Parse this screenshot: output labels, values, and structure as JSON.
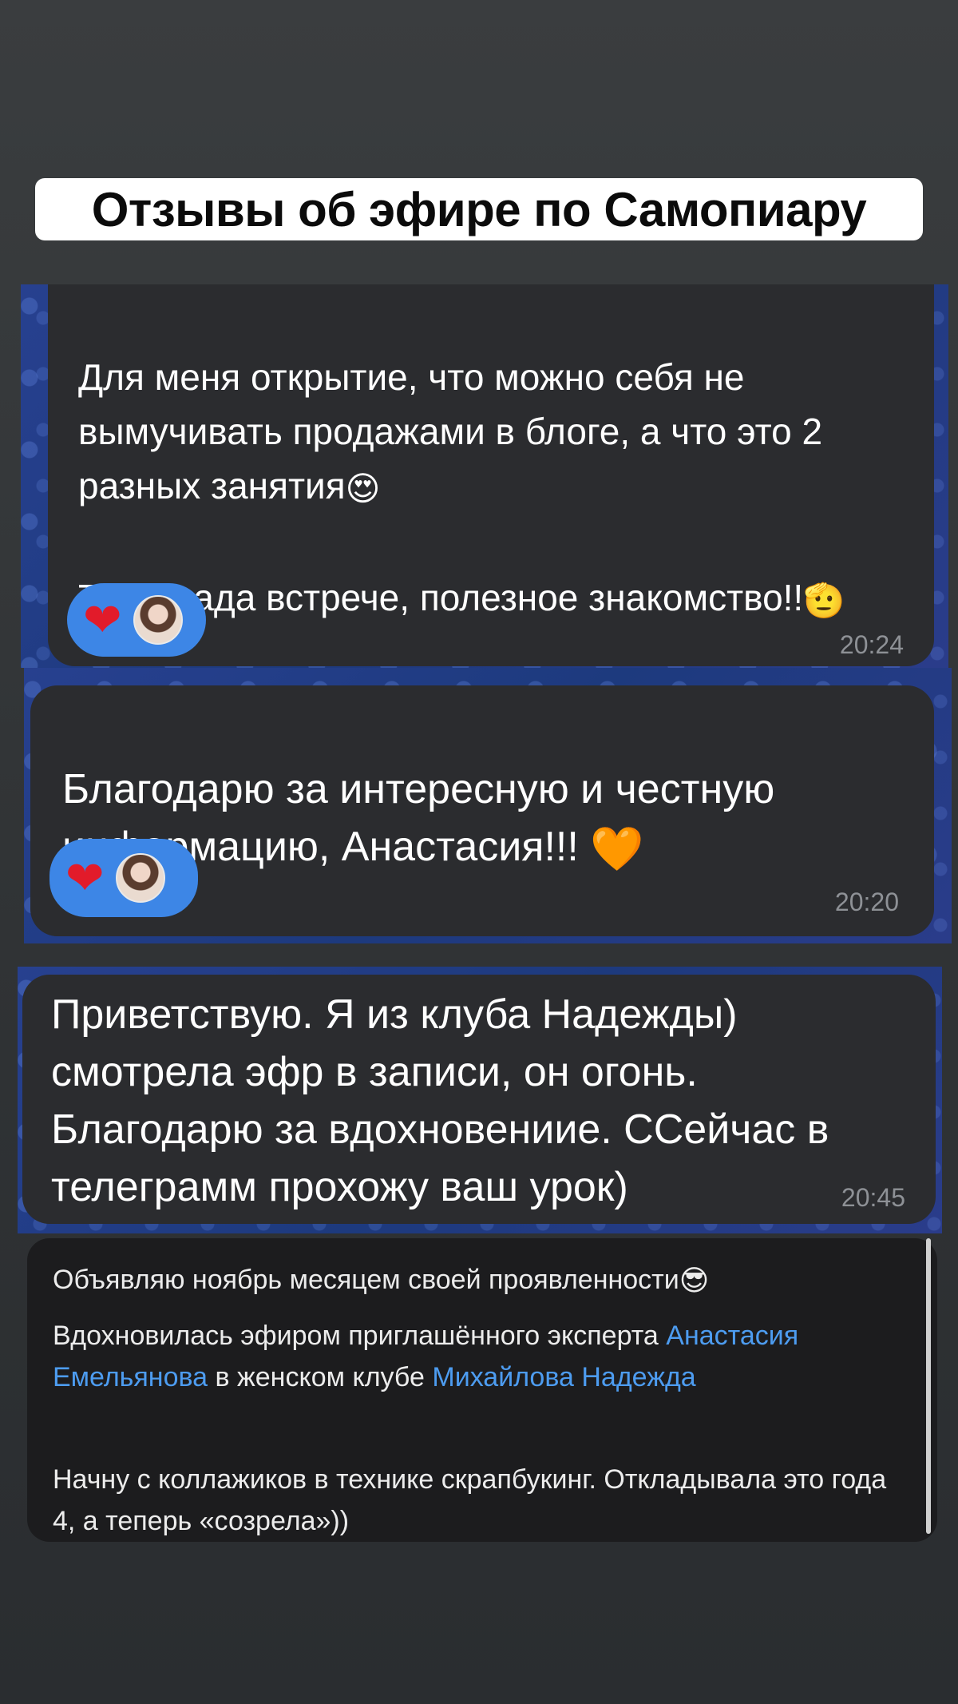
{
  "title": "Отзывы об эфире по Самопиару",
  "messages": [
    {
      "text": "Для меня открытие, что можно себя не вымучивать продажами в блоге, а что это 2 разных занятия",
      "emoji1": "😍",
      "text2": "Тоже рада встрече, полезное знакомство!!",
      "emoji2": "🫡",
      "reaction": "❤",
      "time": "20:24"
    },
    {
      "text": "Благодарю за интересную и честную информацию, Анастасия!!!",
      "emoji": "🧡",
      "reaction": "❤",
      "time": "20:20"
    },
    {
      "text": "Приветствую. Я из клуба Надежды) смотрела эфр в записи, он огонь. Благодарю за вдохновениие. ССейчас в телеграмм прохожу ваш урок)",
      "time": "20:45"
    }
  ],
  "post": {
    "line1": "Объявляю ноябрь месяцем своей проявленности",
    "line1_emoji": "😎",
    "p2_start": "Вдохновилась эфиром приглашённого эксперта ",
    "link1": "Анастасия Емельянова",
    "p2_mid": " в женском клубе ",
    "link2": "Михайлова Надежда",
    "p3": "Начну с коллажиков в технике скрапбукинг. Откладывала это года 4, а теперь «созрела»))"
  },
  "colors": {
    "bubble": "#2b2c2f",
    "reaction_pill": "#3d86e6",
    "link": "#4d9cf0",
    "chat_background": "#223a85"
  }
}
